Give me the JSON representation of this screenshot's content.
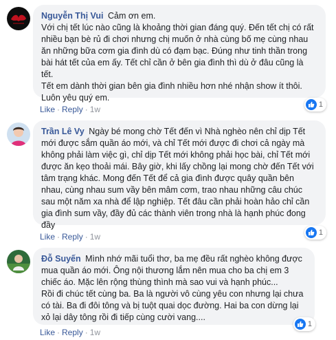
{
  "comments": [
    {
      "author": "Nguyễn Thị Vui",
      "paragraphs": [
        "Cảm ơn em.",
        "Với chị tết lúc nào cũng là khoảng thời gian đáng quý. Đến tết chị có rất nhiều bạn bè rủ đi chơi nhưng chị muốn ở nhà cùng bố mẹ cùng nhau ăn những bữa cơm gia đình dù có đạm bạc. Đúng như tinh thần trong bài hát tết của em ấy. Tết chỉ cần ở bên gia đình thì dù ở đâu cũng là tết.",
        "Tết em dành thời gian bên gia đình nhiều hơn nhé nhận show ít thôi. Luôn yêu quý em."
      ],
      "like_label": "Like",
      "reply_label": "Reply",
      "time": "1w",
      "reaction_count": "1"
    },
    {
      "author": "Trần Lê Vy",
      "paragraphs": [
        "Ngày bé mong chờ Tết đến vì Nhà nghèo nên chỉ dịp Tết mới được sắm quần áo mới, và chỉ Tết mới được đi chơi cả ngày mà không phải làm việc gì, chỉ dịp Tết mới không phải học bài, chỉ Tết mới được ăn kẹo thoải mái. Bây giờ, khi lấy chồng lại mong chờ đến Tết với tâm trạng khác. Mong đến Tết để cả gia đình được quây quần bên nhau, cùng nhau sum vầy bên mâm cơm, trao nhau những câu chúc sau một năm xa nhà để lập nghiệp. Tết đâu cần phải hoàn hảo chỉ cần gia đình sum vầy, đầy đủ các thành viên trong nhà là hạnh phúc đong đầy"
      ],
      "like_label": "Like",
      "reply_label": "Reply",
      "time": "1w",
      "reaction_count": "1"
    },
    {
      "author": "Đỗ Suyến",
      "paragraphs": [
        "Mình nhớ mãi tuổi thơ, ba mẹ đều rất nghèo không được mua quần áo mới. Ông nội thương lắm nên mua cho ba chị em 3 chiếc áo. Mặc lên rộng thùng thình mà sao vui và hạnh phúc...",
        "Rồi đi chúc tết cùng ba. Ba là người vô cùng yêu con nhưng lại chưa có tài. Ba đi đôi tông và bị tuột quai dọc đường. Hai ba con dừng lại xỏ lại dây tông rồi đi tiếp cùng cười vang...."
      ],
      "like_label": "Like",
      "reply_label": "Reply",
      "time": "1w",
      "reaction_count": "1"
    }
  ],
  "colors": {
    "author": "#385898",
    "bubble": "#f2f3f5",
    "like": "#1877f2"
  }
}
